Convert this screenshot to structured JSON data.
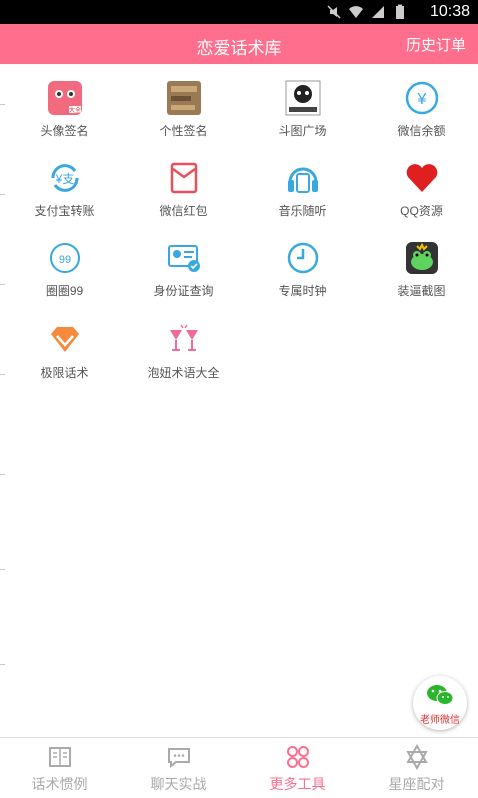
{
  "status": {
    "time": "10:38"
  },
  "header": {
    "title": "恋爱话术库",
    "orders": "历史订单"
  },
  "tools": [
    {
      "label": "头像签名",
      "icon": "avatar-sticker-icon"
    },
    {
      "label": "个性签名",
      "icon": "signature-photo-icon"
    },
    {
      "label": "斗图广场",
      "icon": "meme-icon"
    },
    {
      "label": "微信余额",
      "icon": "yuan-balance-icon"
    },
    {
      "label": "支付宝转账",
      "icon": "alipay-transfer-icon"
    },
    {
      "label": "微信红包",
      "icon": "red-packet-icon"
    },
    {
      "label": "音乐随听",
      "icon": "music-player-icon"
    },
    {
      "label": "QQ资源",
      "icon": "heart-icon"
    },
    {
      "label": "圈圈99",
      "icon": "circle-99-icon"
    },
    {
      "label": "身份证查询",
      "icon": "id-card-icon"
    },
    {
      "label": "专属时钟",
      "icon": "clock-icon"
    },
    {
      "label": "装逼截图",
      "icon": "frog-icon"
    },
    {
      "label": "极限话术",
      "icon": "diamond-icon"
    },
    {
      "label": "泡妞术语大全",
      "icon": "cheers-glasses-icon"
    }
  ],
  "fab": {
    "label": "老师微信"
  },
  "tabs": [
    {
      "label": "话术惯例",
      "icon": "book-icon",
      "active": false
    },
    {
      "label": "聊天实战",
      "icon": "chat-icon",
      "active": false
    },
    {
      "label": "更多工具",
      "icon": "grid-tools-icon",
      "active": true
    },
    {
      "label": "星座配对",
      "icon": "star-icon",
      "active": false
    }
  ],
  "colors": {
    "accent": "#ff6f8d"
  }
}
